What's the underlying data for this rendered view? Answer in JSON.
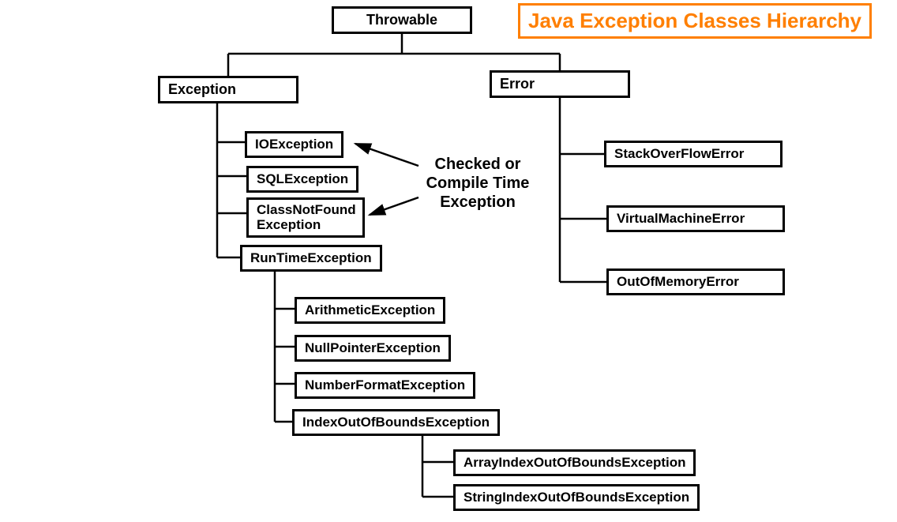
{
  "title": "Java Exception Classes Hierarchy",
  "root": "Throwable",
  "branches": {
    "exception": {
      "label": "Exception",
      "children": {
        "io": "IOException",
        "sql": "SQLException",
        "cnf": "ClassNotFound Exception",
        "rte": {
          "label": "RunTimeException",
          "children": {
            "arith": "ArithmeticException",
            "npe": "NullPointerException",
            "nfe": "NumberFormatException",
            "ioobe": {
              "label": "IndexOutOfBoundsException",
              "children": {
                "aioobe": "ArrayIndexOutOfBoundsException",
                "sioobe": "StringIndexOutOfBoundsException"
              }
            }
          }
        }
      }
    },
    "error": {
      "label": "Error",
      "children": {
        "sof": "StackOverFlowError",
        "vme": "VirtualMachineError",
        "oome": "OutOfMemoryError"
      }
    }
  },
  "annotation": "Checked or Compile Time Exception"
}
